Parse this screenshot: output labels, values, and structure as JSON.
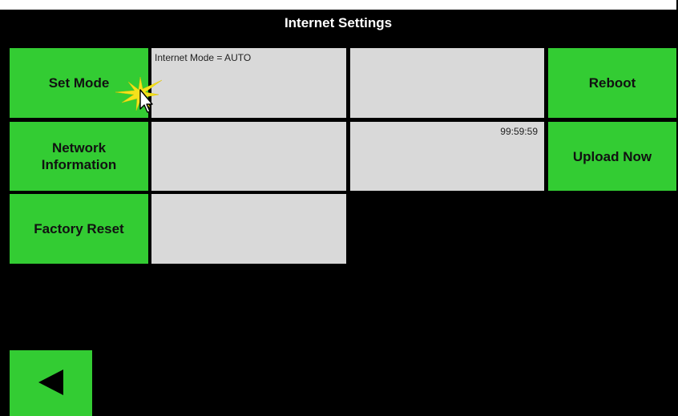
{
  "window": {
    "title": "Internet Settings"
  },
  "buttons": {
    "set_mode": "Set Mode",
    "network_information": "Network\nInformation",
    "factory_reset": "Factory Reset",
    "reboot": "Reboot",
    "upload_now": "Upload Now",
    "back_icon": "left-triangle-icon"
  },
  "panels": {
    "internet_mode": "Internet Mode = AUTO",
    "timer": "99:59:59"
  },
  "colors": {
    "background": "#000000",
    "button": "#33cc33",
    "panel": "#d9d9d9",
    "title_text": "#ffffff"
  }
}
